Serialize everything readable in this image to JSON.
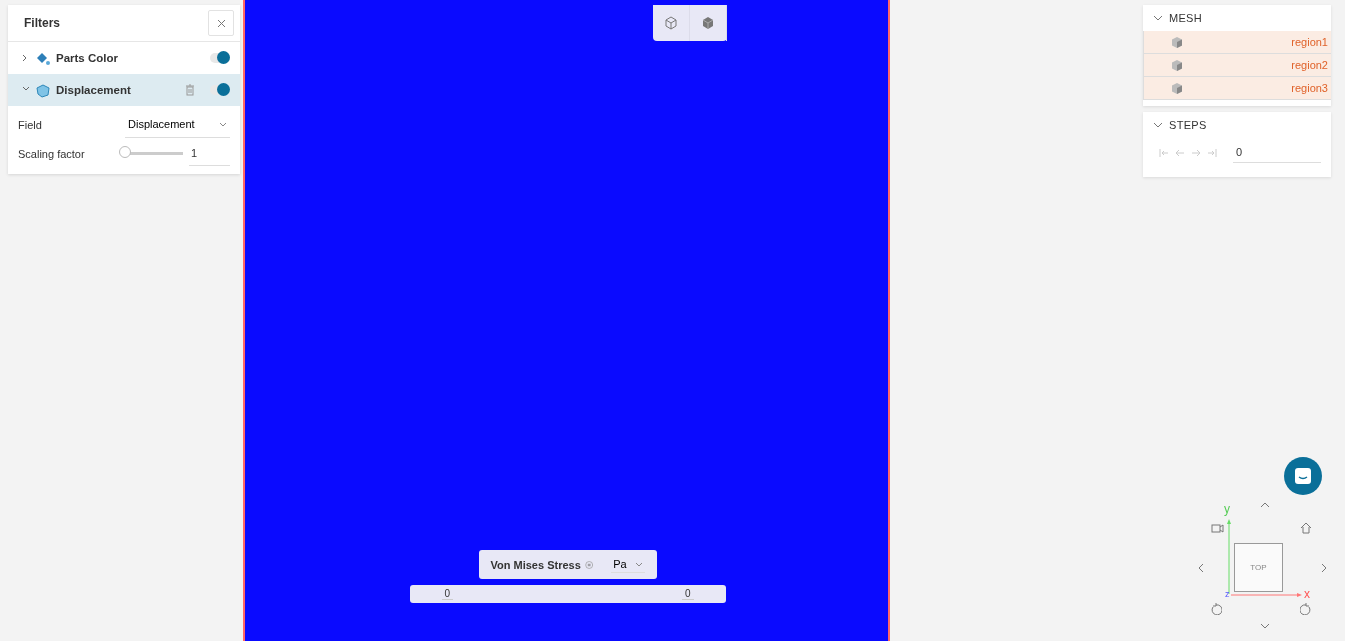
{
  "filters_panel": {
    "title": "Filters",
    "filters": [
      {
        "kind": "color",
        "label": "Parts Color",
        "expanded": false,
        "on": true,
        "deletable": false
      },
      {
        "kind": "displacement",
        "label": "Displacement",
        "expanded": true,
        "on": true,
        "deletable": true
      }
    ],
    "settings": [
      {
        "kind": "select",
        "label": "Field",
        "value": "Displacement"
      },
      {
        "kind": "slider",
        "label": "Scaling factor",
        "level": 0,
        "value": "1"
      }
    ]
  },
  "view_modes": [
    {
      "kind": "wireframe",
      "selected": false
    },
    {
      "kind": "solid",
      "selected": false
    }
  ],
  "legend": {
    "title": "Von Mises Stress",
    "unit": "Pa",
    "min": "0",
    "max": "0"
  },
  "mesh": {
    "title": "MESH",
    "expanded": true,
    "regions": [
      {
        "label": "region1",
        "selected": true
      },
      {
        "label": "region2",
        "selected": true
      },
      {
        "label": "region3",
        "selected": true
      }
    ]
  },
  "steps": {
    "title": "STEPS",
    "expanded": true,
    "value": "0"
  },
  "nav_cube": {
    "face": "TOP",
    "axes": [
      {
        "kind": "y",
        "label": "y"
      },
      {
        "kind": "x",
        "label": "x"
      },
      {
        "kind": "z",
        "label": "z"
      }
    ]
  }
}
